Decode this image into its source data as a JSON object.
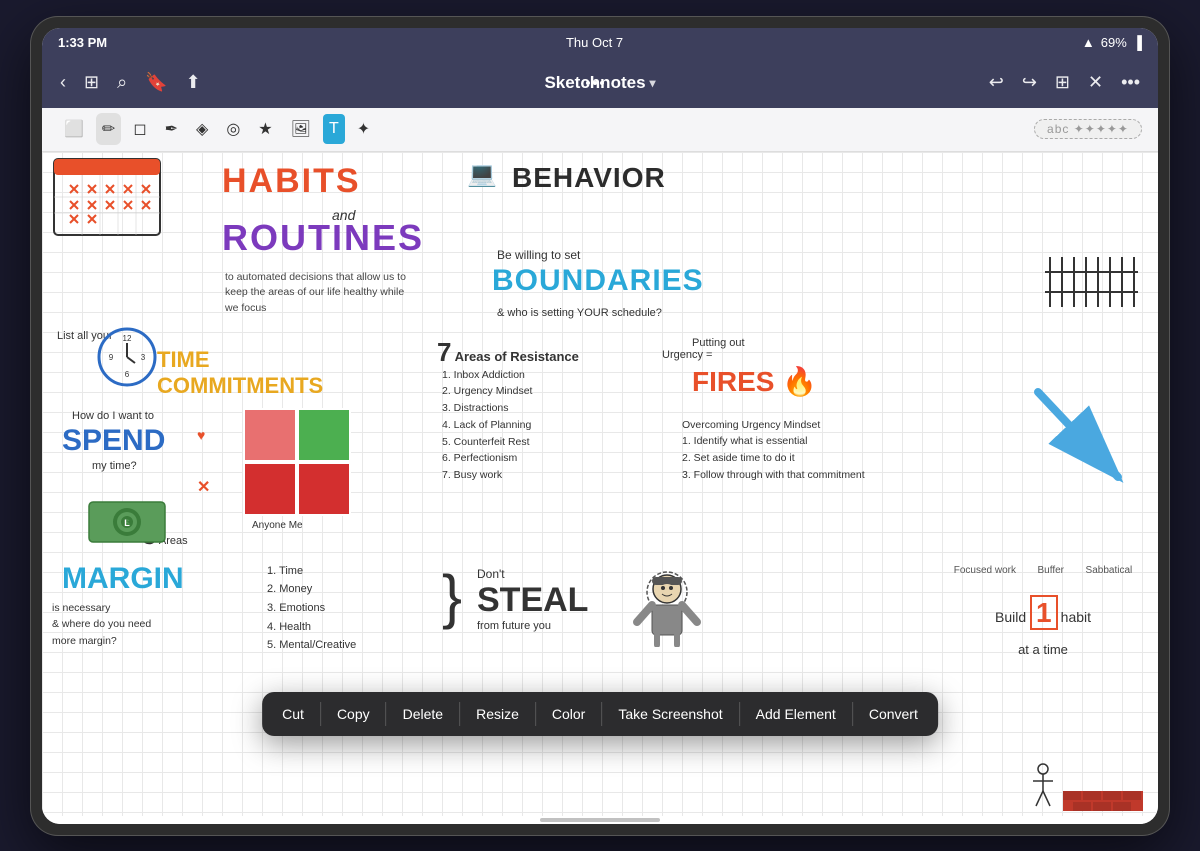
{
  "device": {
    "type": "iPad"
  },
  "statusBar": {
    "time": "1:33 PM",
    "date": "Thu Oct 7",
    "wifi": "WiFi",
    "battery": "69%"
  },
  "navBar": {
    "title": "Sketchnotes",
    "backLabel": "Back",
    "moreLabel": "More options"
  },
  "toolbar": {
    "tools": [
      "Screen",
      "Pen",
      "Eraser",
      "Highlighter",
      "Shapes",
      "Lasso",
      "Star",
      "Image",
      "Text",
      "Magic"
    ],
    "handwritingPlaceholder": "abc ✦✦✦✦✦"
  },
  "contextMenu": {
    "buttons": [
      "Cut",
      "Copy",
      "Delete",
      "Resize",
      "Color",
      "Take Screenshot",
      "Add Element",
      "Convert"
    ]
  },
  "sketchnote": {
    "title1": "HABITS",
    "title2": "BEHAVIOR",
    "and": "and",
    "title3": "ROUTINES",
    "automated": "to automated decisions that allow us to keep the areas of our life healthy while we focus",
    "bewilling": "Be willing to set",
    "title4": "BOUNDARIES",
    "fence": "| | | | | | | |",
    "whosetting": "& who is setting YOUR schedule?",
    "listtime": "List all your",
    "title5": "TIME\nCOMMITMENTS",
    "7areas": "7 Areas of Resistance",
    "urgency": "Urgency =  Putting out",
    "fires": "FIRES 🔥",
    "list7": "1. Inbox Addiction\n2. Urgency Mindset\n3. Distractions\n4. Lack of Planning\n5. Counterfeit Rest\n6. Perfectionism\n7. Busy work",
    "overcoming": "Overcoming Urgency Mindset\n1. Identify what is essential\n2. Set aside time to do it\n3. Follow through with that commitment",
    "howdo": "How do I want to",
    "spend": "SPEND",
    "mytime": "my time?",
    "5areas": "5 Areas",
    "margin": "MARGIN",
    "marginsub": "is necessary\n& where do you need\nmore margin?",
    "dontSteal": "Don't",
    "steal": "STEAL",
    "fromFuture": "from future you",
    "build": "Focused work  Buffer  Sabbatical\nBuild  1  habit\nat a time",
    "areasList": "1. Time\n2. Money\n3. Emotions\n4. Health\n5. Mental/Creative",
    "anyoneMe": "Anyone    Me"
  }
}
